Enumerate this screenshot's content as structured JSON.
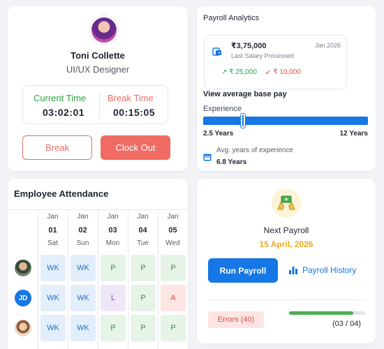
{
  "profile": {
    "name": "Toni Collette",
    "role": "UI/UX Designer",
    "current_time_label": "Current Time",
    "current_time": "03:02:01",
    "break_time_label": "Break Time",
    "break_time": "00:15:05",
    "break_button": "Break",
    "clockout_button": "Clock Out"
  },
  "analytics": {
    "title": "Payroll Analytics",
    "salary_amount": "₹3,75,000",
    "salary_date": "Jan 2026",
    "salary_label": "Last Salary Processed",
    "increase": "₹ 25,000",
    "decrease": "₹ 10,000",
    "subtitle": "View average base pay",
    "experience_label": "Experience",
    "experience_min": "2.5 Years",
    "experience_max": "12 Years",
    "experience_slider_fraction": 0.24,
    "avg_label": "Avg. years of experience",
    "avg_value": "6.8 Years"
  },
  "attendance": {
    "title": "Employee Attendance",
    "days": [
      {
        "month": "Jan",
        "date": "01",
        "weekday": "Sat"
      },
      {
        "month": "Jan",
        "date": "02",
        "weekday": "Sun"
      },
      {
        "month": "Jan",
        "date": "03",
        "weekday": "Mon"
      },
      {
        "month": "Jan",
        "date": "04",
        "weekday": "Tue"
      },
      {
        "month": "Jan",
        "date": "05",
        "weekday": "Wed"
      }
    ],
    "rows": [
      {
        "avatar": "photo",
        "cells": [
          "WK",
          "WK",
          "P",
          "P",
          "P"
        ]
      },
      {
        "avatar": "JD",
        "cells": [
          "WK",
          "WK",
          "L",
          "P",
          "A"
        ]
      },
      {
        "avatar": "photo",
        "cells": [
          "WK",
          "WK",
          "P",
          "P",
          "P"
        ]
      }
    ]
  },
  "payroll": {
    "next_label": "Next Payroll",
    "next_date": "15 April, 2026",
    "run_button": "Run Payroll",
    "history_link": "Payroll History",
    "errors_badge": "Errors (40)",
    "progress_text": "(03 / 04)",
    "progress_fraction": 0.84
  },
  "colors": {
    "accent_blue": "#1677e5",
    "danger_red": "#ef6b63",
    "success_green": "#27a35a",
    "warning_orange": "#f0a81a"
  }
}
